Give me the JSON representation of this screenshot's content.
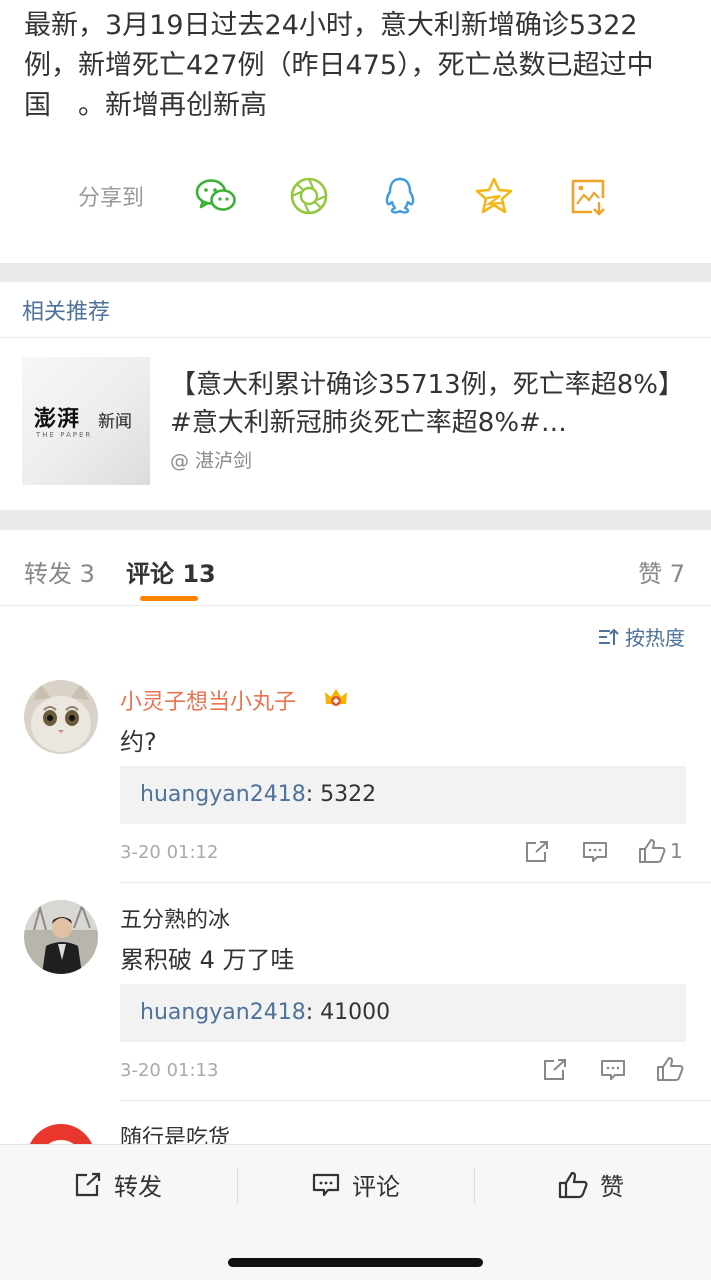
{
  "post": {
    "text": "最新，3月19日过去24小时，意大利新增确诊5322例，新增死亡427例（昨日475），死亡总数已超过中国　。新增再创新高"
  },
  "share": {
    "label": "分享到",
    "icons": [
      "wechat-icon",
      "moments-icon",
      "qq-icon",
      "qzone-icon",
      "save-image-icon"
    ],
    "colors": {
      "green": "#3cb034",
      "moments_green": "#93c83e",
      "qq_blue": "#3f9be0",
      "star_yellow": "#f4b719",
      "image_orange": "#f0a32a"
    }
  },
  "related": {
    "title": "相关推荐",
    "thumb_logo": "澎湃",
    "thumb_sub": "THE PAPER",
    "thumb_news": "新闻",
    "text": "【意大利累计确诊35713例，死亡率超8%】#意大利新冠肺炎死亡率超8%#…",
    "author": "@ 湛泸剑"
  },
  "tabs": {
    "repost": "转发 3",
    "comments": "评论 13",
    "likes": "赞 7",
    "active": "comments",
    "accent": "#ff8200"
  },
  "sort": {
    "label": "按热度"
  },
  "comments": [
    {
      "name": "小灵子想当小丸子",
      "name_color": "#eb7350",
      "vip_badge": "crown-badge-icon",
      "text": "约?",
      "reply_user": "huangyan2418",
      "reply_text": ": 5322",
      "time": "3-20 01:12",
      "like_count": "1"
    },
    {
      "name": "五分熟的冰",
      "name_color": "#333333",
      "text": "累积破 4 万了哇",
      "reply_user": "huangyan2418",
      "reply_text": ": 41000",
      "time": "3-20 01:13",
      "like_count": ""
    },
    {
      "name": "随行是吃货",
      "name_color": "#333333"
    }
  ],
  "bottom_bar": {
    "repost": "转发",
    "comment": "评论",
    "like": "赞"
  }
}
